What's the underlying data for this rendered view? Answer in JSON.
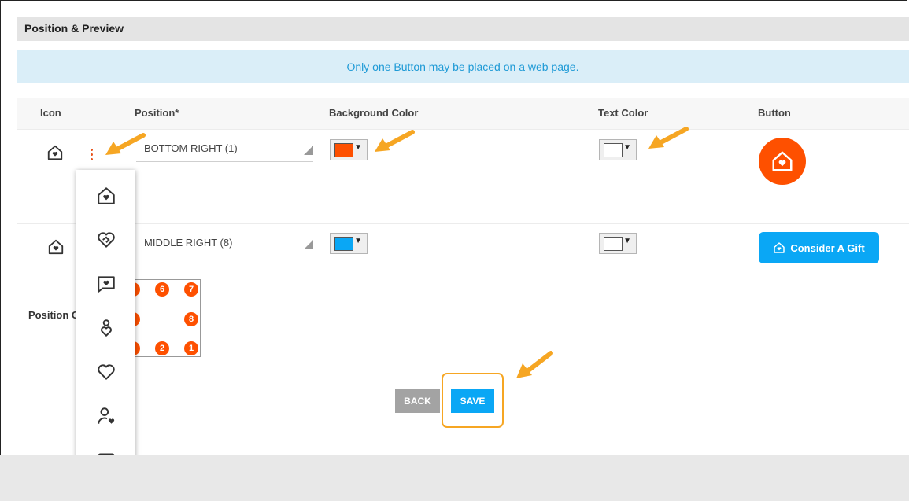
{
  "section": {
    "title": "Position & Preview"
  },
  "notice": {
    "text": "Only one Button may be placed on a web page."
  },
  "table": {
    "headers": {
      "icon": "Icon",
      "position": "Position*",
      "background": "Background Color",
      "text": "Text Color",
      "button": "Button"
    },
    "rows": [
      {
        "position": "BOTTOM RIGHT (1)",
        "background_color": "#fe5000",
        "text_color": "#ffffff",
        "button_style": "circle"
      },
      {
        "position": "MIDDLE RIGHT (8)",
        "background_color": "#0aa7f5",
        "text_color": "#ffffff",
        "button_style": "pill",
        "button_label": "Consider A Gift"
      }
    ]
  },
  "position_grid": {
    "label": "Position Gr",
    "numbers": [
      "6",
      "7",
      "8",
      "2",
      "1"
    ]
  },
  "icon_menu": {
    "icons": [
      "house-heart-icon",
      "heart-handshake-icon",
      "message-heart-icon",
      "person-heart-icon",
      "heart-icon",
      "user-heart-icon",
      "wallet-icon"
    ]
  },
  "actions": {
    "back": "BACK",
    "save": "SAVE"
  },
  "colors": {
    "accent": "#fe5000",
    "primary": "#0aa7f5",
    "annotation": "#f6a623"
  }
}
